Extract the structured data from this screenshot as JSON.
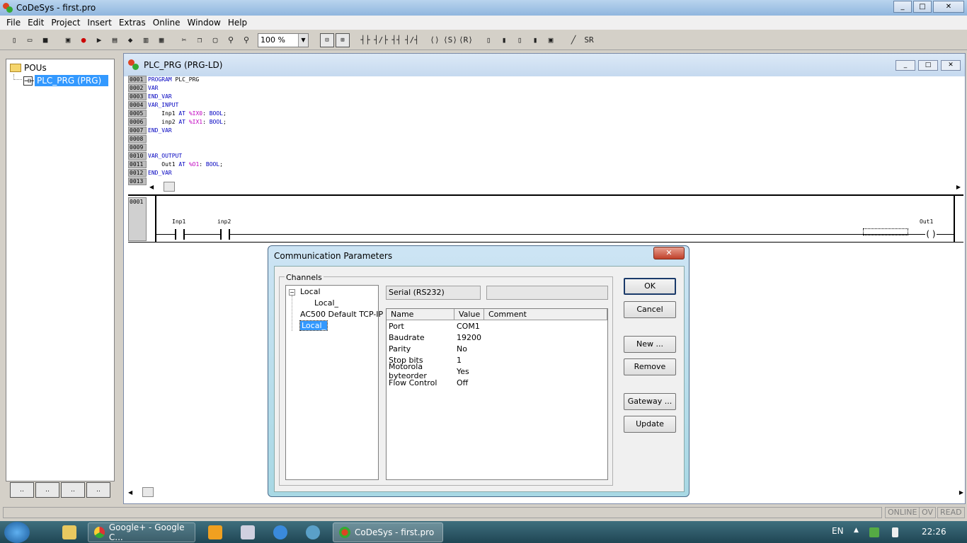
{
  "window": {
    "title": "CoDeSys - first.pro",
    "minimize": "_",
    "maximize": "□",
    "close": "✕"
  },
  "menu": [
    "File",
    "Edit",
    "Project",
    "Insert",
    "Extras",
    "Online",
    "Window",
    "Help"
  ],
  "toolbar": {
    "zoom": "100 %",
    "zoom_arrow": "▼"
  },
  "pou_panel": {
    "root": "POUs",
    "item_icon": "⊣⊢",
    "item": "PLC_PRG (PRG)",
    "tabs": [
      "..",
      "..",
      "..",
      ".."
    ]
  },
  "editor": {
    "title": "PLC_PRG (PRG-LD)",
    "declaration_lines": [
      {
        "ln": "0001",
        "parts": [
          [
            "kw",
            "PROGRAM"
          ],
          [
            "",
            " PLC_PRG"
          ]
        ]
      },
      {
        "ln": "0002",
        "parts": [
          [
            "kw",
            "VAR"
          ]
        ]
      },
      {
        "ln": "0003",
        "parts": [
          [
            "kw",
            "END_VAR"
          ]
        ]
      },
      {
        "ln": "0004",
        "parts": [
          [
            "kw",
            "VAR_INPUT"
          ]
        ]
      },
      {
        "ln": "0005",
        "parts": [
          [
            "",
            "    Inp1 "
          ],
          [
            "kw",
            "AT"
          ],
          [
            "addr",
            " %IX0"
          ],
          [
            "",
            ": "
          ],
          [
            "kw",
            "BOOL"
          ],
          [
            "",
            ";"
          ]
        ]
      },
      {
        "ln": "0006",
        "parts": [
          [
            "",
            "    inp2 "
          ],
          [
            "kw",
            "AT"
          ],
          [
            "addr",
            " %IX1"
          ],
          [
            "",
            ": "
          ],
          [
            "kw",
            "BOOL"
          ],
          [
            "",
            ";"
          ]
        ]
      },
      {
        "ln": "0007",
        "parts": [
          [
            "kw",
            "END_VAR"
          ]
        ]
      },
      {
        "ln": "0008",
        "parts": []
      },
      {
        "ln": "0009",
        "parts": []
      },
      {
        "ln": "0010",
        "parts": [
          [
            "kw",
            "VAR_OUTPUT"
          ]
        ]
      },
      {
        "ln": "0011",
        "parts": [
          [
            "",
            "    Out1 "
          ],
          [
            "kw",
            "AT"
          ],
          [
            "addr",
            " %O1"
          ],
          [
            "",
            ": "
          ],
          [
            "kw",
            "BOOL"
          ],
          [
            "",
            ";"
          ]
        ]
      },
      {
        "ln": "0012",
        "parts": [
          [
            "kw",
            "END_VAR"
          ]
        ]
      },
      {
        "ln": "0013",
        "parts": []
      }
    ],
    "network_number": "0001",
    "contact1": "Inp1",
    "contact2": "inp2",
    "coil": "Out1",
    "coil_symbol": "( )"
  },
  "dialog": {
    "title": "Communication Parameters",
    "close": "✕",
    "channels_label": "Channels",
    "tree": {
      "expander": "−",
      "node1": "Local",
      "node1_child": "Local_",
      "node2": "AC500 Default TCP-IP",
      "node3": "Local_"
    },
    "channel_type": "Serial (RS232)",
    "columns": [
      "Name",
      "Value",
      "Comment"
    ],
    "params": [
      {
        "name": "Port",
        "value": "COM1",
        "comment": ""
      },
      {
        "name": "Baudrate",
        "value": "19200",
        "comment": ""
      },
      {
        "name": "Parity",
        "value": "No",
        "comment": ""
      },
      {
        "name": "Stop bits",
        "value": "1",
        "comment": ""
      },
      {
        "name": "Motorola byteorder",
        "value": "Yes",
        "comment": ""
      },
      {
        "name": "Flow Control",
        "value": "Off",
        "comment": ""
      }
    ],
    "buttons": {
      "ok": "OK",
      "cancel": "Cancel",
      "new": "New ...",
      "remove": "Remove",
      "gateway": "Gateway ...",
      "update": "Update"
    }
  },
  "status": {
    "online": "ONLINE",
    "ov": "OV",
    "read": "READ"
  },
  "taskbar": {
    "chrome": "Google+ - Google C...",
    "codesys": "CoDeSys - first.pro",
    "lang": "EN",
    "tray_arrow": "▲",
    "time": "22:26"
  }
}
